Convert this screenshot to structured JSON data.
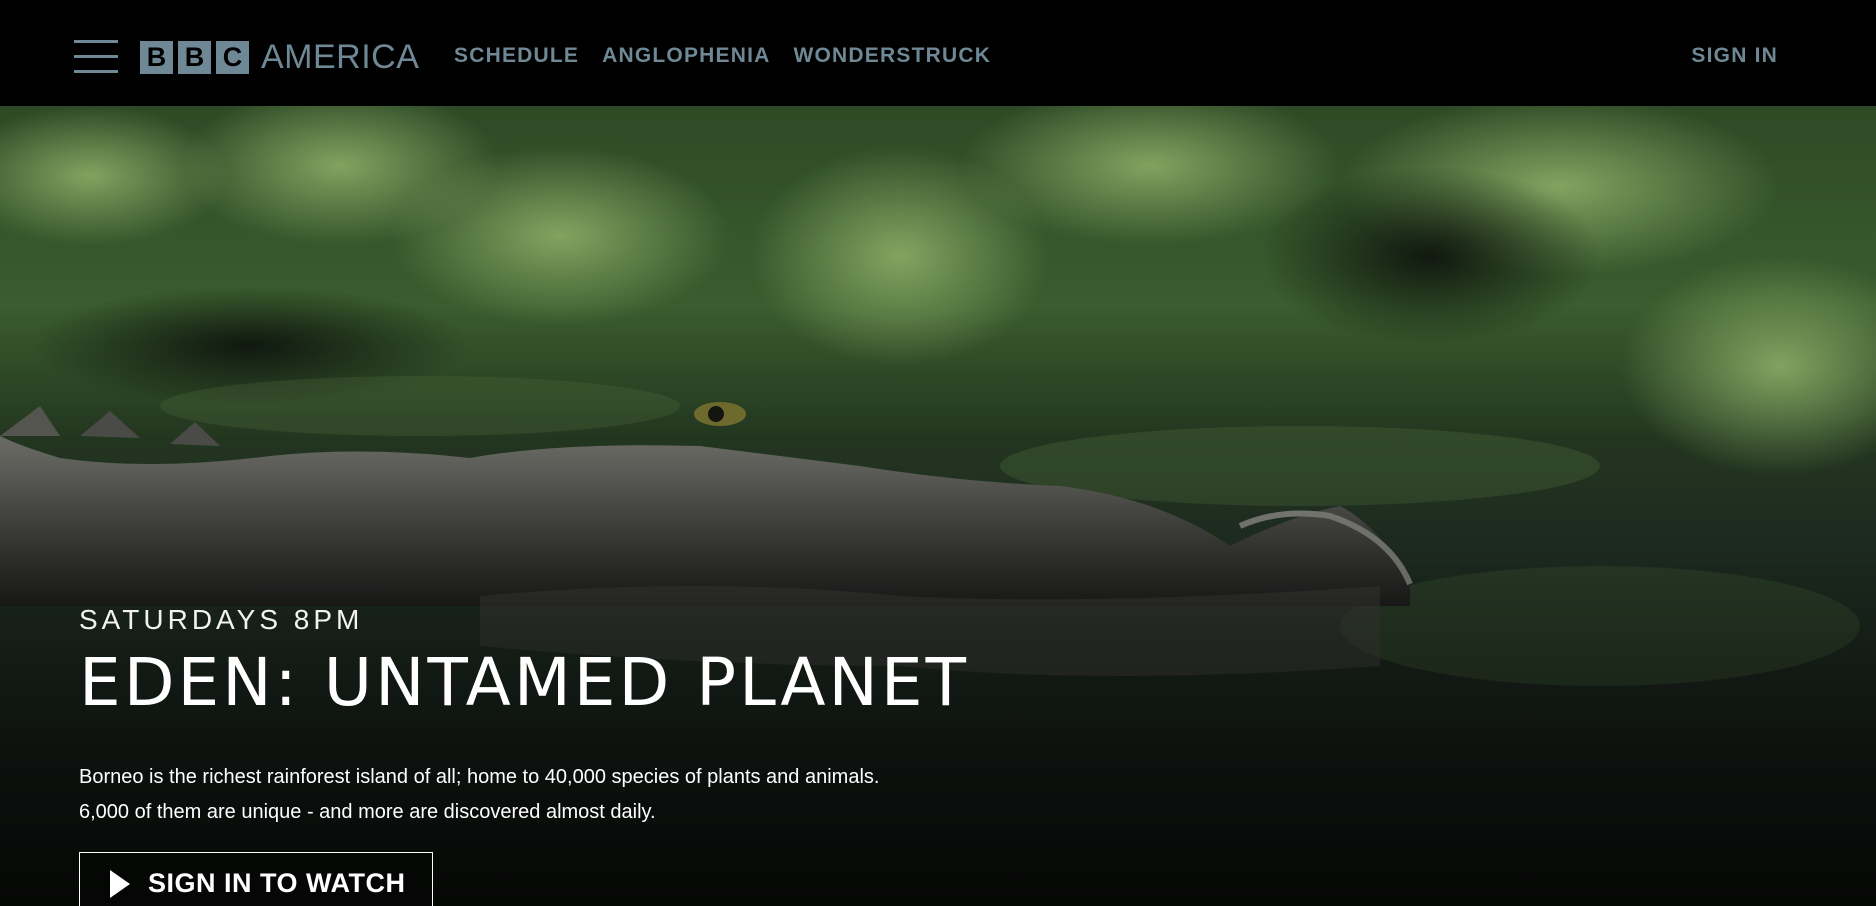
{
  "header": {
    "logo": {
      "letters": [
        "B",
        "B",
        "C"
      ],
      "word": "AMERICA"
    },
    "nav": [
      {
        "label": "SCHEDULE"
      },
      {
        "label": "ANGLOPHENIA"
      },
      {
        "label": "WONDERSTRUCK"
      }
    ],
    "sign_in_label": "SIGN IN",
    "menu_icon": "hamburger-menu-icon",
    "accent_color": "#6f8895"
  },
  "hero": {
    "airtime": "SATURDAYS 8PM",
    "title": "EDEN: UNTAMED PLANET",
    "description_line1": "Borneo is the richest rainforest island of all; home to 40,000 species of plants and animals.",
    "description_line2": "6,000 of them are unique - and more are discovered almost daily.",
    "cta_label": "SIGN IN TO WATCH",
    "cta_icon": "play-icon"
  }
}
